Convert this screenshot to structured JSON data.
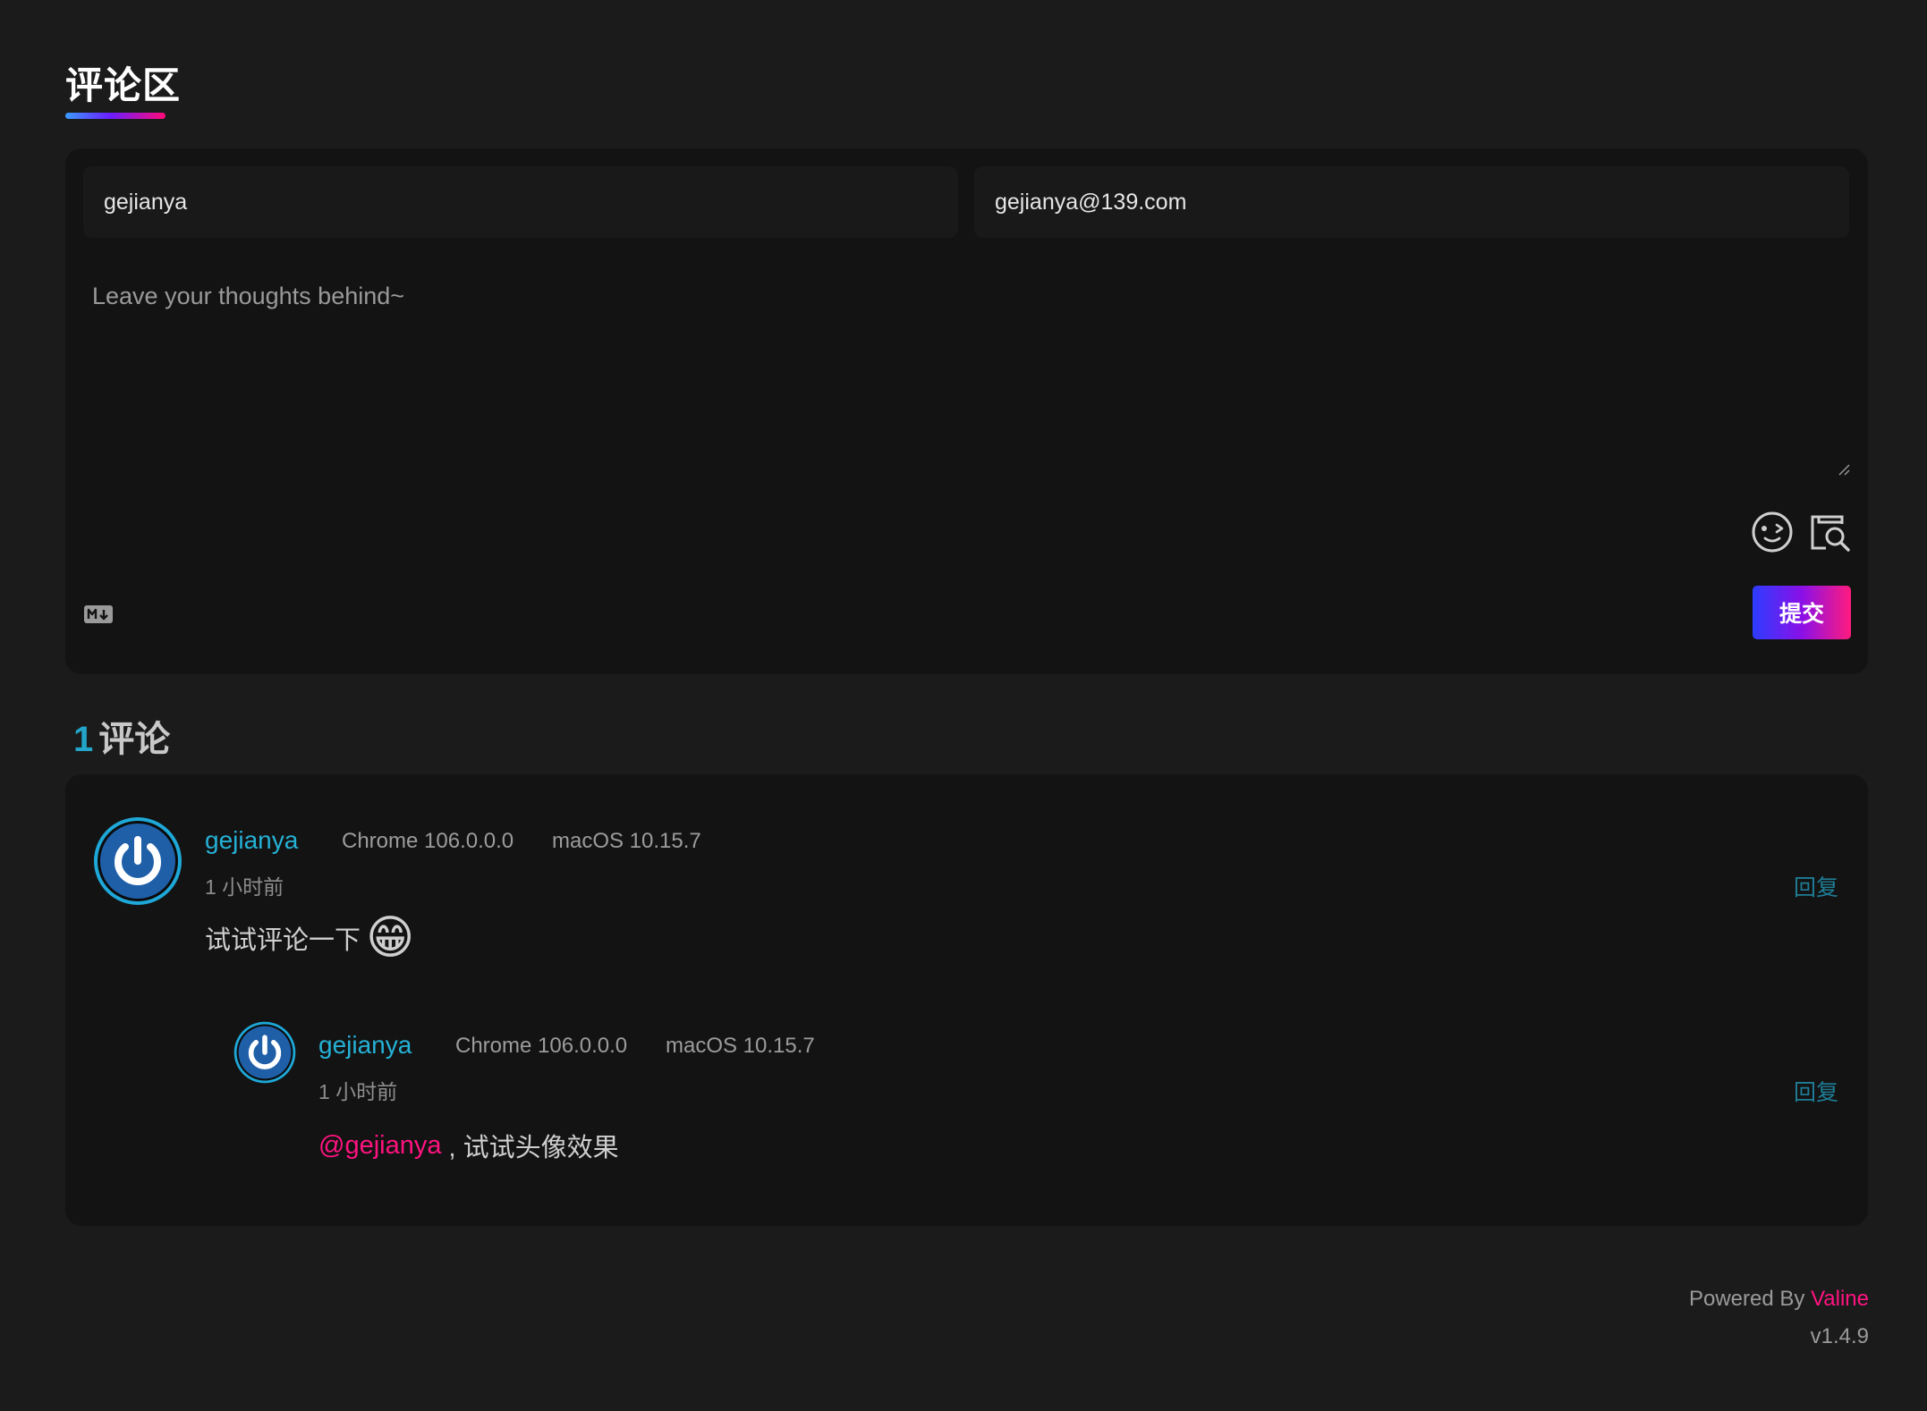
{
  "section": {
    "title": "评论区"
  },
  "form": {
    "nick_value": "gejianya",
    "mail_value": "gejianya@139.com",
    "textarea_placeholder": "Leave your thoughts behind~",
    "submit_label": "提交",
    "markdown_badge": "markdown-icon",
    "emoji_tool": "emoji-icon",
    "preview_tool": "preview-icon"
  },
  "count": {
    "number": "1",
    "label": "评论"
  },
  "comments": [
    {
      "nick": "gejianya",
      "browser": "Chrome 106.0.0.0",
      "os": "macOS 10.15.7",
      "time": "1 小时前",
      "reply_label": "回复",
      "text": "试试评论一下",
      "emoji": "😁",
      "replies": [
        {
          "nick": "gejianya",
          "browser": "Chrome 106.0.0.0",
          "os": "macOS 10.15.7",
          "time": "1 小时前",
          "reply_label": "回复",
          "mention": "@gejianya",
          "text": " , 试试头像效果"
        }
      ]
    }
  ],
  "footer": {
    "powered_prefix": "Powered By ",
    "brand": "Valine",
    "version": "v1.4.9"
  },
  "colors": {
    "background": "#1b1b1b",
    "panel": "#131313",
    "accent_cyan": "#25b1d6",
    "accent_pink": "#ff1380"
  }
}
